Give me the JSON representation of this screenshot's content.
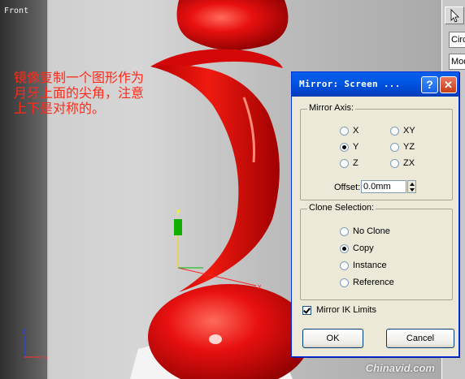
{
  "viewport": {
    "label": "Front",
    "annotation_lines": [
      "镜像复制一个图形作为",
      "月牙上面的尖角，注意",
      "上下是对称的。"
    ],
    "gizmo": {
      "y_label": "y",
      "x_label": "x"
    },
    "corner_axes": {
      "z_label": "z",
      "x_label": "x"
    },
    "watermark": "Chinavid.com"
  },
  "command_panel": {
    "field1": "Circ",
    "field2": "Mod"
  },
  "dialog": {
    "title": "Mirror: Screen ...",
    "help_glyph": "?",
    "close_glyph": "✕",
    "mirror_axis": {
      "label": "Mirror Axis:",
      "options": [
        "X",
        "Y",
        "Z",
        "XY",
        "YZ",
        "ZX"
      ],
      "selected": "Y",
      "offset_label": "Offset:",
      "offset_value": "0.0mm"
    },
    "clone_selection": {
      "label": "Clone Selection:",
      "options": [
        "No Clone",
        "Copy",
        "Instance",
        "Reference"
      ],
      "selected": "Copy"
    },
    "mirror_ik": {
      "label": "Mirror IK Limits",
      "checked": true
    },
    "ok_label": "OK",
    "cancel_label": "Cancel"
  }
}
